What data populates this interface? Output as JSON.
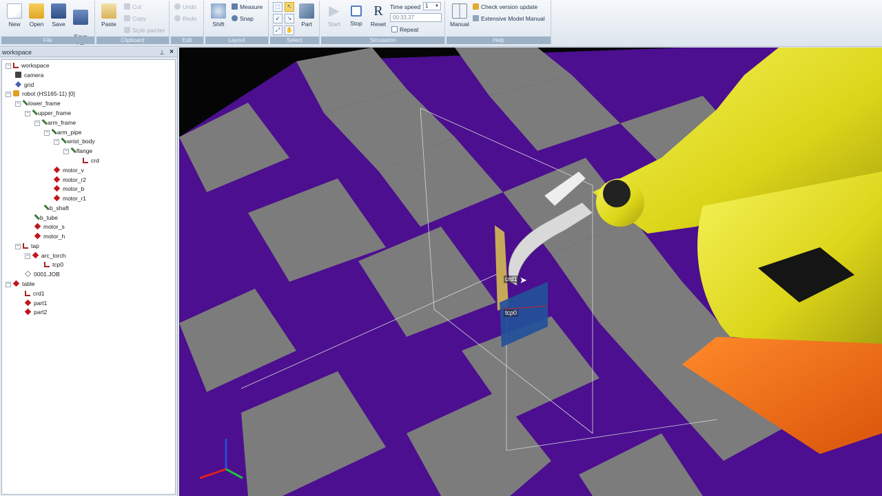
{
  "ribbon": {
    "file": {
      "label": "File",
      "new": "New",
      "open": "Open",
      "save": "Save",
      "save_as": "Save\nAs"
    },
    "clipboard": {
      "label": "Clipboard",
      "paste": "Paste",
      "cut": "Cut",
      "copy": "Copy",
      "style_painter": "Style painter"
    },
    "edit": {
      "label": "Edit",
      "undo": "Undo",
      "redo": "Redo"
    },
    "layout": {
      "label": "Layout",
      "shift": "Shift",
      "measure": "Measure",
      "snap": "Snap"
    },
    "select": {
      "label": "Select",
      "part": "Part"
    },
    "simulation": {
      "label": "Simulation",
      "start": "Start",
      "stop": "Stop",
      "reset": "Reset",
      "time_speed_label": "Time speed",
      "time_speed_value": "1",
      "time_value": "00:33.37",
      "repeat": "Repeat"
    },
    "help": {
      "label": "Help",
      "manual": "Manual",
      "check_update": "Check version update",
      "extensive_manual": "Extensive Model Manual"
    }
  },
  "panel": {
    "title": "workspace",
    "tree": [
      {
        "label": "workspace",
        "icon": "frame-icon"
      },
      {
        "label": "camera",
        "icon": "camera-icon"
      },
      {
        "label": "grid",
        "icon": "grid-icon"
      },
      {
        "label": "robot (HS165-11) [0]",
        "icon": "robot-icon"
      },
      {
        "label": "lower_frame",
        "icon": "link-icon"
      },
      {
        "label": "upper_frame",
        "icon": "link-icon"
      },
      {
        "label": "arm_frame",
        "icon": "link-icon"
      },
      {
        "label": "arm_pipe",
        "icon": "link-icon"
      },
      {
        "label": "wrist_body",
        "icon": "link-icon"
      },
      {
        "label": "flange",
        "icon": "link-icon"
      },
      {
        "label": "crd",
        "icon": "frame-icon"
      },
      {
        "label": "motor_v",
        "icon": "diamond-icon"
      },
      {
        "label": "motor_r2",
        "icon": "diamond-icon"
      },
      {
        "label": "motor_b",
        "icon": "diamond-icon"
      },
      {
        "label": "motor_r1",
        "icon": "diamond-icon"
      },
      {
        "label": "b_shaft",
        "icon": "link-icon"
      },
      {
        "label": "b_tube",
        "icon": "link-icon"
      },
      {
        "label": "motor_s",
        "icon": "diamond-icon"
      },
      {
        "label": "motor_h",
        "icon": "diamond-icon"
      },
      {
        "label": "tap",
        "icon": "frame-icon"
      },
      {
        "label": "arc_torch",
        "icon": "diamond-icon"
      },
      {
        "label": "tcp0",
        "icon": "frame-icon"
      },
      {
        "label": "0001.JOB",
        "icon": "job-icon"
      },
      {
        "label": "table",
        "icon": "diamond-icon"
      },
      {
        "label": "crd1",
        "icon": "frame-icon"
      },
      {
        "label": "part1",
        "icon": "diamond-icon"
      },
      {
        "label": "part2",
        "icon": "diamond-icon"
      }
    ]
  },
  "viewport": {
    "labels": {
      "crd1": "crd1",
      "tcp0": "tcp0"
    },
    "colors": {
      "floor_purple": "#4b0f8f",
      "floor_gray": "#7c7c7c",
      "robot_yellow": "#e6e21a",
      "base_orange": "#f26a10"
    }
  }
}
